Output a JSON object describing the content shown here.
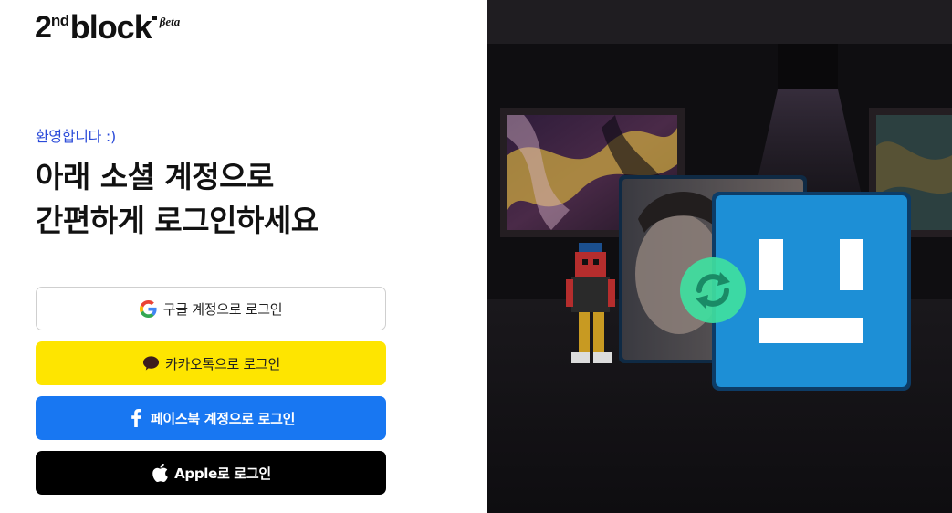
{
  "logo": {
    "num": "2",
    "sup": "nd",
    "word": "block",
    "beta": "βeta"
  },
  "welcome": "환영합니다 :)",
  "headline": {
    "line1": "아래 소셜 계정으로",
    "line2": "간편하게 로그인하세요"
  },
  "buttons": {
    "google": {
      "label": "구글 계정으로 로그인",
      "icon": "google-icon"
    },
    "kakao": {
      "label": "카카오톡으로 로그인",
      "icon": "speech-bubble-icon"
    },
    "facebook": {
      "label": "페이스북 계정으로 로그인",
      "icon": "facebook-icon"
    },
    "apple": {
      "label": "Apple로 로그인",
      "icon": "apple-icon"
    }
  },
  "colors": {
    "welcome_text": "#2b4bd9",
    "kakao_yellow": "#fee500",
    "facebook_blue": "#1877f2",
    "apple_black": "#000000",
    "hero_blue": "#1d8fd6",
    "swap_green": "#3fe0a0"
  }
}
